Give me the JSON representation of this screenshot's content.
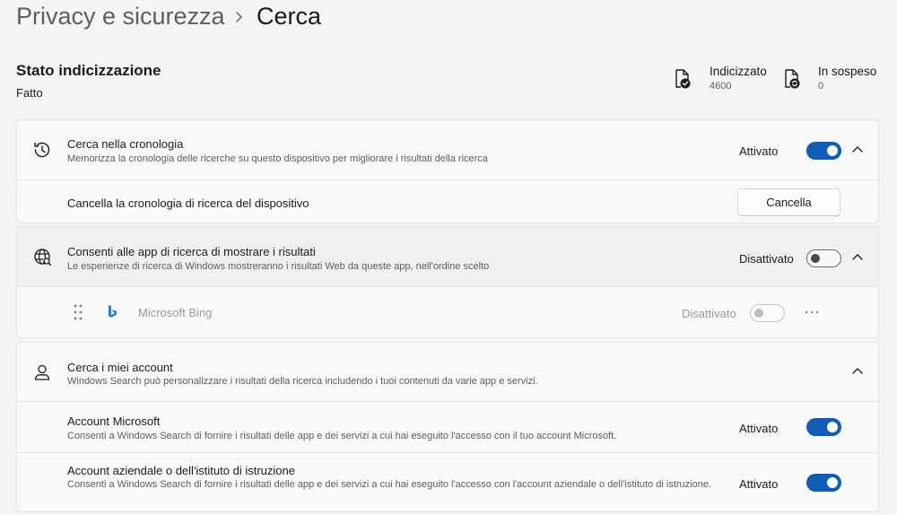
{
  "breadcrumb": {
    "parent": "Privacy e sicurezza",
    "separator_icon": "chevron-right-icon",
    "current": "Cerca"
  },
  "indexing": {
    "title": "Stato indicizzazione",
    "status": "Fatto",
    "indexed": {
      "label": "Indicizzato",
      "value": "4600",
      "icon": "file-check-icon"
    },
    "pending": {
      "label": "In sospeso",
      "value": "0",
      "icon": "file-sync-icon"
    }
  },
  "history": {
    "icon": "history-icon",
    "title": "Cerca nella cronologia",
    "description": "Memorizza la cronologia delle ricerche su questo dispositivo per migliorare i risultati della ricerca",
    "state": "Attivato",
    "enabled": true,
    "clear_label": "Cancella la cronologia di ricerca del dispositivo",
    "clear_button": "Cancella"
  },
  "web_results": {
    "icon": "globe-icon",
    "title": "Consenti alle app di ricerca di mostrare i risultati",
    "description": "Le esperienze di ricerca di Windows mostreranno i risultati Web da queste app, nell'ordine scelto",
    "state": "Disattivato",
    "enabled": false,
    "apps": [
      {
        "name": "Microsoft Bing",
        "icon": "bing-icon",
        "state": "Disattivato",
        "enabled": false
      }
    ]
  },
  "accounts": {
    "icon": "person-icon",
    "title": "Cerca i miei account",
    "description": "Windows Search può personalizzare i risultati della ricerca includendo i tuoi contenuti da varie app e servizi.",
    "items": [
      {
        "title": "Account Microsoft",
        "description": "Consenti a Windows Search di fornire i risultati delle app e dei servizi a cui hai eseguito l'accesso con il tuo account Microsoft.",
        "state": "Attivato",
        "enabled": true
      },
      {
        "title": "Account aziendale o dell'istituto di istruzione",
        "description": "Consenti a Windows Search di fornire i risultati delle app e dei servizi a cui hai eseguito l'accesso con l'account aziendale o dell'istituto di istruzione.",
        "state": "Attivato",
        "enabled": true
      }
    ]
  },
  "colors": {
    "accent": "#0f5db6",
    "background": "#f3f5f4",
    "card": "#f8faf9"
  }
}
